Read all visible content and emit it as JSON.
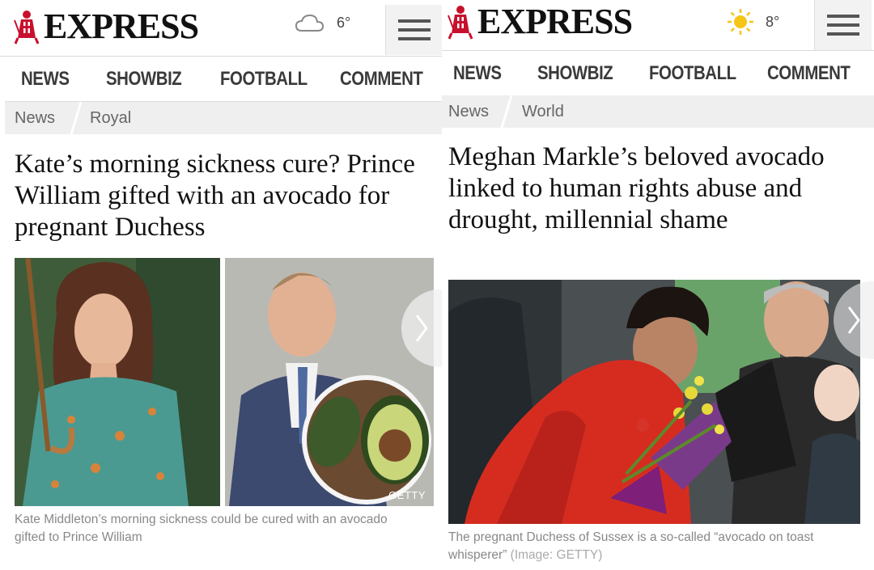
{
  "left": {
    "logo_text": "EXPRESS",
    "weather": {
      "icon": "cloud-icon",
      "temp": "6°"
    },
    "nav": [
      "NEWS",
      "SHOWBIZ",
      "FOOTBALL",
      "COMMENT"
    ],
    "breadcrumb": [
      "News",
      "Royal"
    ],
    "headline": "Kate’s morning sickness cure? Prince William gifted with an avocado for pregnant Duchess",
    "image_credit": "GETTY",
    "caption": "Kate Middleton’s morning sickness could be cured with an avocado gifted to Prince William"
  },
  "right": {
    "logo_text": "EXPRESS",
    "weather": {
      "icon": "sun-icon",
      "temp": "8°"
    },
    "nav": [
      "NEWS",
      "SHOWBIZ",
      "FOOTBALL",
      "COMMENT"
    ],
    "breadcrumb": [
      "News",
      "World"
    ],
    "headline": "Meghan Markle’s beloved avocado linked to human rights abuse and drought, millennial shame",
    "caption": "The pregnant Duchess of Sussex is a so-called “avocado on toast whisperer”",
    "caption_credit": "(Image: GETTY)"
  },
  "colors": {
    "brand_red": "#c8102e",
    "sun": "#f5c518",
    "caption_gray": "#888888"
  }
}
